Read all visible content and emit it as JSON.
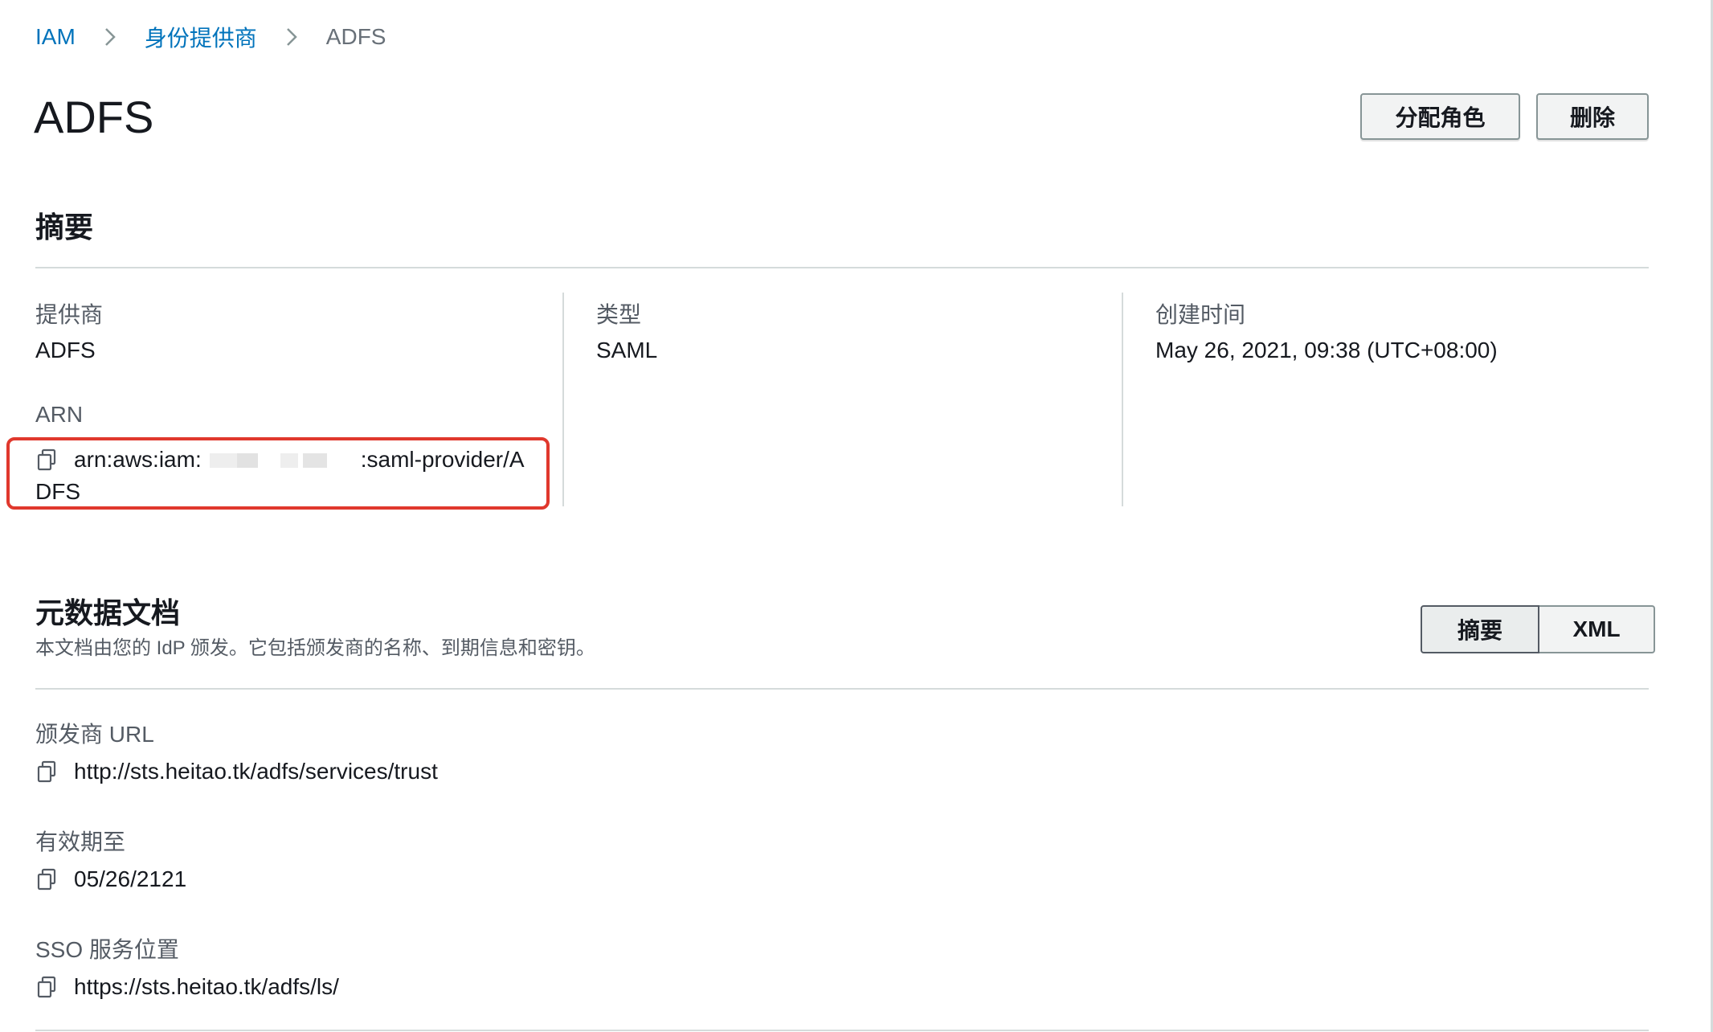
{
  "breadcrumb": {
    "items": [
      "IAM",
      "身份提供商"
    ],
    "current": "ADFS"
  },
  "header": {
    "title": "ADFS",
    "assign_role_label": "分配角色",
    "delete_label": "删除"
  },
  "summary": {
    "title": "摘要",
    "provider_label": "提供商",
    "provider_value": "ADFS",
    "arn_label": "ARN",
    "arn_prefix": "arn:aws:iam:",
    "arn_suffix": ":saml-provider/A",
    "arn_wrap": "DFS",
    "type_label": "类型",
    "type_value": "SAML",
    "created_label": "创建时间",
    "created_value": "May 26, 2021, 09:38 (UTC+08:00)"
  },
  "metadata": {
    "title": "元数据文档",
    "description": "本文档由您的 IdP 颁发。它包括颁发商的名称、到期信息和密钥。",
    "toggle": {
      "summary_label": "摘要",
      "xml_label": "XML",
      "selected": "摘要"
    },
    "issuer_label": "颁发商 URL",
    "issuer_value": "http://sts.heitao.tk/adfs/services/trust",
    "expiry_label": "有效期至",
    "expiry_value": "05/26/2121",
    "sso_label": "SSO 服务位置",
    "sso_value": "https://sts.heitao.tk/adfs/ls/"
  },
  "colors": {
    "link": "#0073bb",
    "highlight_border": "#e0382d",
    "divider": "#d5dbdb"
  },
  "icons": {
    "breadcrumb_separator": "chevron-right-icon",
    "copy": "copy-icon"
  }
}
